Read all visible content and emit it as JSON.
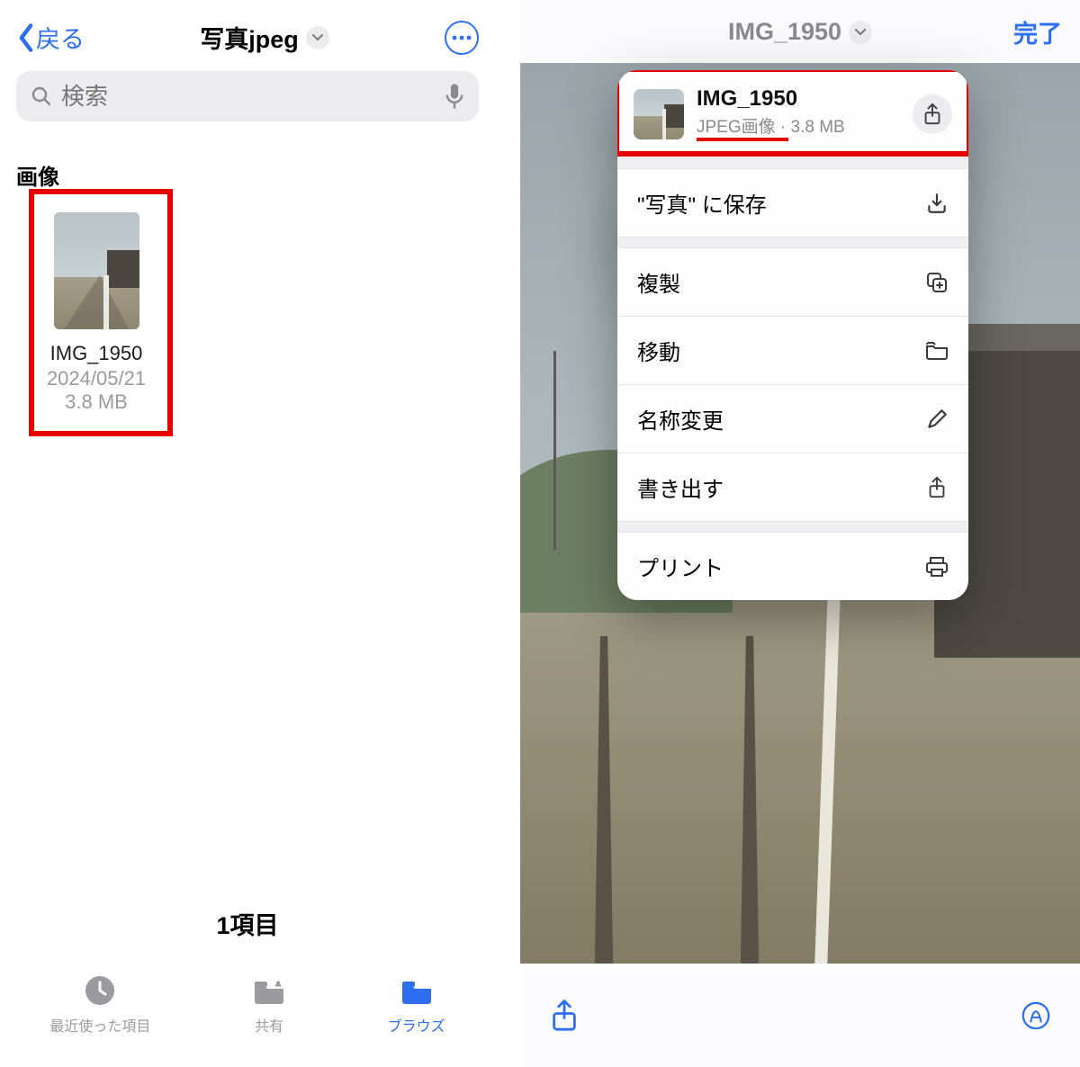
{
  "left": {
    "back_label": "戻る",
    "title": "写真jpeg",
    "search_placeholder": "検索",
    "section": "画像",
    "file": {
      "name": "IMG_1950",
      "date": "2024/05/21",
      "size": "3.8 MB"
    },
    "footer_count": "1項目",
    "tabs": {
      "recent": "最近使った項目",
      "shared": "共有",
      "browse": "ブラウズ"
    }
  },
  "right": {
    "title": "IMG_1950",
    "done": "完了",
    "info": {
      "name": "IMG_1950",
      "type": "JPEG画像",
      "size": "3.8 MB",
      "separator": " · "
    },
    "menu": {
      "save_to_photos": "\"写真\" に保存",
      "duplicate": "複製",
      "move": "移動",
      "rename": "名称変更",
      "export": "書き出す",
      "print": "プリント"
    }
  }
}
